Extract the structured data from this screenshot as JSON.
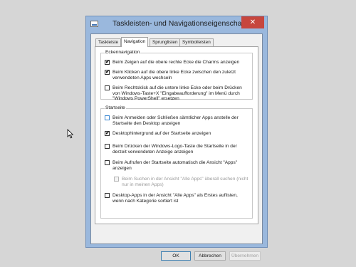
{
  "window": {
    "title": "Taskleisten- und Navigationseigenschaften",
    "close_glyph": "✕"
  },
  "tabs": [
    {
      "label": "Taskleiste",
      "active": false
    },
    {
      "label": "Navigation",
      "active": true
    },
    {
      "label": "Sprunglisten",
      "active": false
    },
    {
      "label": "Symbolleisten",
      "active": false
    }
  ],
  "corner_nav": {
    "title": "Eckennavigation",
    "options": [
      {
        "label": "Beim Zeigen auf die obere rechte Ecke die Charms anzeigen",
        "checked": true
      },
      {
        "label": "Beim Klicken auf die obere linke Ecke zwischen den zuletzt verwendeten Apps wechseln",
        "checked": true
      },
      {
        "label": "Beim Rechtsklick auf die untere linke Ecke oder beim Drücken von Windows-Taste+X \"Eingabeaufforderung\" im Menü durch \"Windows PowerShell\" ersetzen",
        "checked": false
      }
    ]
  },
  "start_page": {
    "title": "Startseite",
    "options": [
      {
        "label": "Beim Anmelden oder Schließen sämtlicher Apps anstelle der Startseite den Desktop anzeigen",
        "checked": false,
        "hover": true
      },
      {
        "label": "Desktophintergrund auf der Startseite anzeigen",
        "checked": true
      },
      {
        "label": "Beim Drücken der Windows-Logo-Taste die Startseite in der derzeit verwendeten Anzeige anzeigen",
        "checked": false
      },
      {
        "label": "Beim Aufrufen der Startseite automatisch die Ansicht \"Apps\" anzeigen",
        "checked": false
      },
      {
        "label": "Beim Suchen in der Ansicht \"Alle Apps\" überall suchen (nicht nur in meinen Apps)",
        "checked": false,
        "disabled": true
      },
      {
        "label": "Desktop-Apps in der Ansicht \"Alle Apps\" als Erstes auflisten, wenn nach Kategorie sortiert ist",
        "checked": false
      }
    ]
  },
  "buttons": {
    "ok": "OK",
    "cancel": "Abbrechen",
    "apply": "Übernehmen"
  },
  "check_glyph": "✔"
}
